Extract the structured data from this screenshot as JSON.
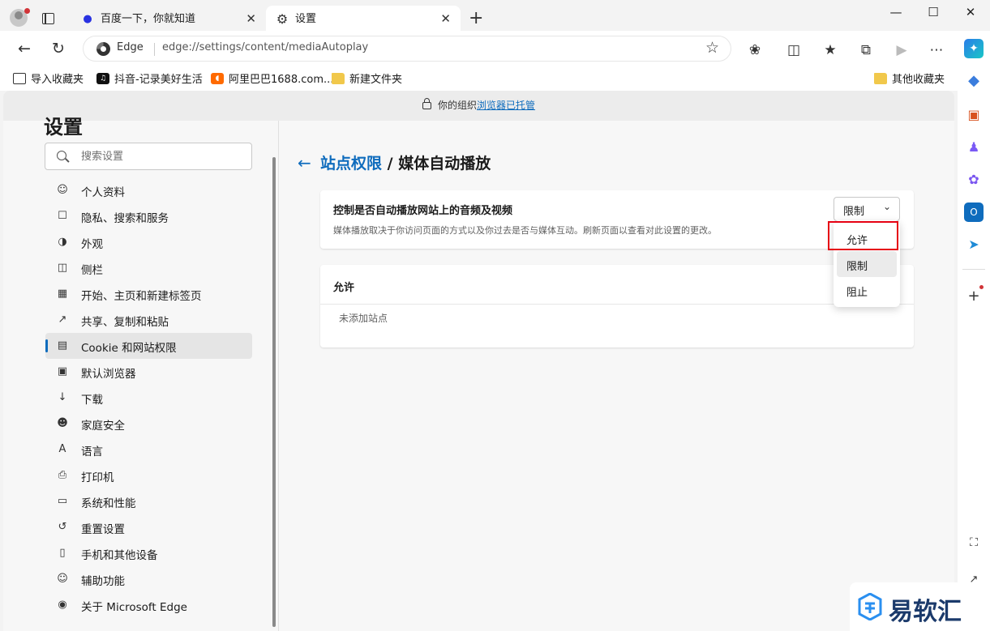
{
  "browser": {
    "tabs": [
      {
        "title": "百度一下，你就知道",
        "favicon": "baidu-paw-icon"
      },
      {
        "title": "设置",
        "favicon": "gear-icon",
        "active": true
      }
    ],
    "address": {
      "site_label": "Edge",
      "url": "edge://settings/content/mediaAutoplay"
    },
    "favorites": [
      {
        "label": "导入收藏夹",
        "icon": "import-icon"
      },
      {
        "label": "抖音-记录美好生活",
        "icon": "tiktok-icon"
      },
      {
        "label": "阿里巴巴1688.com...",
        "icon": "alibaba-icon"
      },
      {
        "label": "新建文件夹",
        "icon": "folder-icon"
      },
      {
        "label": "其他收藏夹",
        "icon": "folder-icon"
      }
    ]
  },
  "managed_bar": {
    "prefix": "你的组织",
    "link": "浏览器已托管"
  },
  "settings_nav": {
    "title": "设置",
    "search_placeholder": "搜索设置",
    "items": [
      {
        "label": "个人资料",
        "icon": "profile-icon"
      },
      {
        "label": "隐私、搜索和服务",
        "icon": "lock-icon"
      },
      {
        "label": "外观",
        "icon": "palette-icon"
      },
      {
        "label": "侧栏",
        "icon": "sidebar-icon"
      },
      {
        "label": "开始、主页和新建标签页",
        "icon": "home-icon"
      },
      {
        "label": "共享、复制和粘贴",
        "icon": "share-icon"
      },
      {
        "label": "Cookie 和网站权限",
        "icon": "cookie-icon",
        "active": true
      },
      {
        "label": "默认浏览器",
        "icon": "browser-icon"
      },
      {
        "label": "下载",
        "icon": "download-icon"
      },
      {
        "label": "家庭安全",
        "icon": "family-icon"
      },
      {
        "label": "语言",
        "icon": "language-icon"
      },
      {
        "label": "打印机",
        "icon": "printer-icon"
      },
      {
        "label": "系统和性能",
        "icon": "laptop-icon"
      },
      {
        "label": "重置设置",
        "icon": "reset-icon"
      },
      {
        "label": "手机和其他设备",
        "icon": "phone-icon"
      },
      {
        "label": "辅助功能",
        "icon": "accessibility-icon"
      },
      {
        "label": "关于 Microsoft Edge",
        "icon": "edge-icon"
      }
    ]
  },
  "page": {
    "breadcrumb_parent": "站点权限",
    "breadcrumb_sep": " / ",
    "breadcrumb_current": "媒体自动播放",
    "control_card": {
      "title": "控制是否自动播放网站上的音频及视频",
      "description": "媒体播放取决于你访问页面的方式以及你过去是否与媒体互动。刷新页面以查看对此设置的更改。",
      "select_value": "限制"
    },
    "allow_card": {
      "title": "允许",
      "empty_text": "未添加站点"
    },
    "dropdown_options": [
      "允许",
      "限制",
      "阻止"
    ],
    "dropdown_selected": "限制"
  },
  "watermark": {
    "text": "易软汇"
  },
  "colors": {
    "accent": "#0f6cbd",
    "highlight": "#e60012"
  }
}
